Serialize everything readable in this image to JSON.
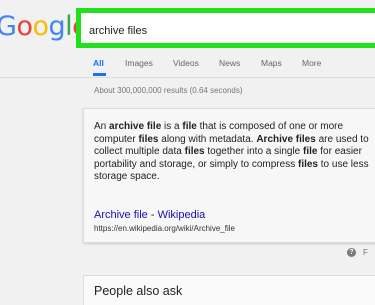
{
  "logo": {
    "letters": [
      "G",
      "o",
      "o",
      "g",
      "l",
      "e"
    ]
  },
  "search": {
    "query": "archive files"
  },
  "tabs": [
    {
      "label": "All",
      "active": true
    },
    {
      "label": "Images",
      "active": false
    },
    {
      "label": "Videos",
      "active": false
    },
    {
      "label": "News",
      "active": false
    },
    {
      "label": "Maps",
      "active": false
    },
    {
      "label": "More",
      "active": false
    }
  ],
  "result_stats": "About 300,000,000 results (0.64 seconds)",
  "featured_snippet": {
    "parts": [
      {
        "t": "An ",
        "b": false
      },
      {
        "t": "archive file",
        "b": true
      },
      {
        "t": " is a ",
        "b": false
      },
      {
        "t": "file",
        "b": true
      },
      {
        "t": " that is composed of one or more computer ",
        "b": false
      },
      {
        "t": "files",
        "b": true
      },
      {
        "t": " along with metadata. ",
        "b": false
      },
      {
        "t": "Archive files",
        "b": true
      },
      {
        "t": " are used to collect multiple data ",
        "b": false
      },
      {
        "t": "files",
        "b": true
      },
      {
        "t": " together into a single ",
        "b": false
      },
      {
        "t": "file",
        "b": true
      },
      {
        "t": " for easier portability and storage, or simply to compress ",
        "b": false
      },
      {
        "t": "files",
        "b": true
      },
      {
        "t": " to use less storage space.",
        "b": false
      }
    ],
    "link_title": "Archive file - Wikipedia",
    "url": "https://en.wikipedia.org/wiki/Archive_file"
  },
  "feedback": {
    "icon": "help-icon",
    "label": "F"
  },
  "people_also_ask": {
    "title": "People also ask"
  },
  "colors": {
    "highlight_border": "#21e11b",
    "link": "#1a0dab",
    "tab_active": "#1a73e8",
    "logo_blue": "#4285f4",
    "logo_red": "#ea4335",
    "logo_yellow": "#fbbc05",
    "logo_green": "#34a853"
  }
}
